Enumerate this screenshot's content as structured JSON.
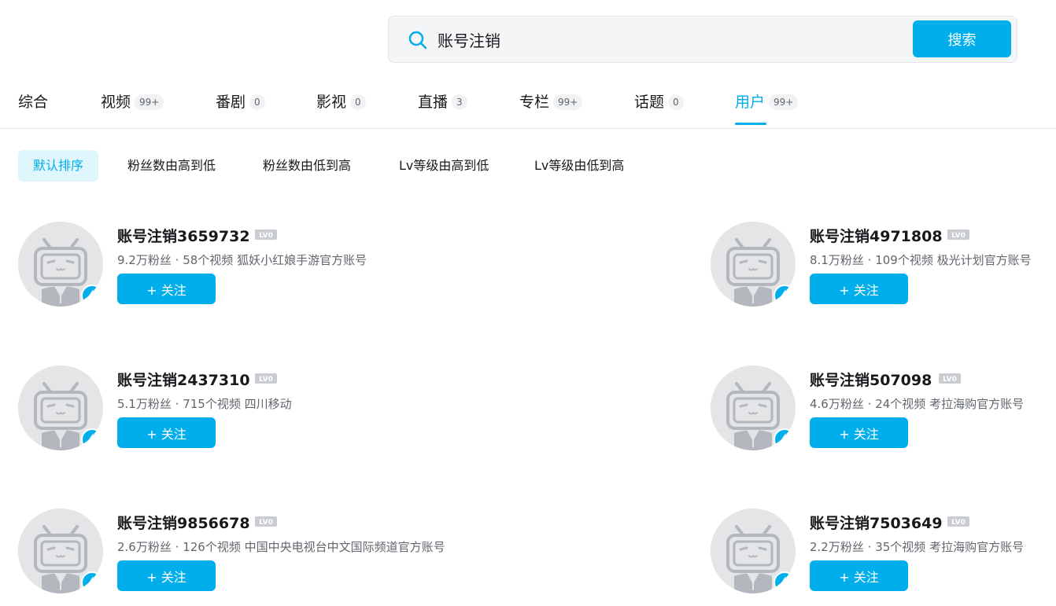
{
  "search": {
    "query": "账号注销",
    "button_label": "搜索"
  },
  "tabs": [
    {
      "label": "综合",
      "count": ""
    },
    {
      "label": "视频",
      "count": "99+"
    },
    {
      "label": "番剧",
      "count": "0"
    },
    {
      "label": "影视",
      "count": "0"
    },
    {
      "label": "直播",
      "count": "3"
    },
    {
      "label": "专栏",
      "count": "99+"
    },
    {
      "label": "话题",
      "count": "0"
    },
    {
      "label": "用户",
      "count": "99+",
      "active": true
    }
  ],
  "sort": {
    "items": [
      "默认排序",
      "粉丝数由高到低",
      "粉丝数由低到高",
      "Lv等级由高到低",
      "Lv等级由低到高"
    ],
    "active_index": 0
  },
  "level_label": "LV0",
  "users": [
    {
      "name": "账号注销3659732",
      "fans": "9.2万粉丝",
      "videos": "58个视频",
      "desc": "狐妖小红娘手游官方账号",
      "follow_label": "+ 关注"
    },
    {
      "name": "账号注销4971808",
      "fans": "8.1万粉丝",
      "videos": "109个视频",
      "desc": "极光计划官方账号",
      "follow_label": "+ 关注"
    },
    {
      "name": "账号注销2437310",
      "fans": "5.1万粉丝",
      "videos": "715个视频",
      "desc": "四川移动",
      "follow_label": "+ 关注"
    },
    {
      "name": "账号注销507098",
      "fans": "4.6万粉丝",
      "videos": "24个视频",
      "desc": "考拉海购官方账号",
      "follow_label": "+ 关注"
    },
    {
      "name": "账号注销9856678",
      "fans": "2.6万粉丝",
      "videos": "126个视频",
      "desc": "中国中央电视台中文国际频道官方账号",
      "follow_label": "+ 关注"
    },
    {
      "name": "账号注销7503649",
      "fans": "2.2万粉丝",
      "videos": "35个视频",
      "desc": "考拉海购官方账号",
      "follow_label": "+ 关注"
    }
  ],
  "colors": {
    "accent": "#00aeec",
    "text": "#18191c",
    "secondary_text": "#61666d",
    "avatar_bg": "#e3e5e7"
  }
}
